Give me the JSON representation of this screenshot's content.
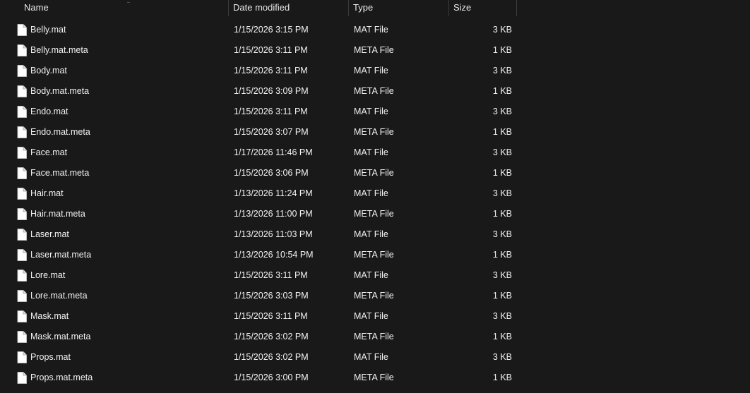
{
  "columns": {
    "name": "Name",
    "date": "Date modified",
    "type": "Type",
    "size": "Size"
  },
  "icons": {
    "file": "file-icon"
  },
  "files": [
    {
      "name": "Belly.mat",
      "date": "1/15/2026 3:15 PM",
      "type": "MAT File",
      "size": "3 KB"
    },
    {
      "name": "Belly.mat.meta",
      "date": "1/15/2026 3:11 PM",
      "type": "META File",
      "size": "1 KB"
    },
    {
      "name": "Body.mat",
      "date": "1/15/2026 3:11 PM",
      "type": "MAT File",
      "size": "3 KB"
    },
    {
      "name": "Body.mat.meta",
      "date": "1/15/2026 3:09 PM",
      "type": "META File",
      "size": "1 KB"
    },
    {
      "name": "Endo.mat",
      "date": "1/15/2026 3:11 PM",
      "type": "MAT File",
      "size": "3 KB"
    },
    {
      "name": "Endo.mat.meta",
      "date": "1/15/2026 3:07 PM",
      "type": "META File",
      "size": "1 KB"
    },
    {
      "name": "Face.mat",
      "date": "1/17/2026 11:46 PM",
      "type": "MAT File",
      "size": "3 KB"
    },
    {
      "name": "Face.mat.meta",
      "date": "1/15/2026 3:06 PM",
      "type": "META File",
      "size": "1 KB"
    },
    {
      "name": "Hair.mat",
      "date": "1/13/2026 11:24 PM",
      "type": "MAT File",
      "size": "3 KB"
    },
    {
      "name": "Hair.mat.meta",
      "date": "1/13/2026 11:00 PM",
      "type": "META File",
      "size": "1 KB"
    },
    {
      "name": "Laser.mat",
      "date": "1/13/2026 11:03 PM",
      "type": "MAT File",
      "size": "3 KB"
    },
    {
      "name": "Laser.mat.meta",
      "date": "1/13/2026 10:54 PM",
      "type": "META File",
      "size": "1 KB"
    },
    {
      "name": "Lore.mat",
      "date": "1/15/2026 3:11 PM",
      "type": "MAT File",
      "size": "3 KB"
    },
    {
      "name": "Lore.mat.meta",
      "date": "1/15/2026 3:03 PM",
      "type": "META File",
      "size": "1 KB"
    },
    {
      "name": "Mask.mat",
      "date": "1/15/2026 3:11 PM",
      "type": "MAT File",
      "size": "3 KB"
    },
    {
      "name": "Mask.mat.meta",
      "date": "1/15/2026 3:02 PM",
      "type": "META File",
      "size": "1 KB"
    },
    {
      "name": "Props.mat",
      "date": "1/15/2026 3:02 PM",
      "type": "MAT File",
      "size": "3 KB"
    },
    {
      "name": "Props.mat.meta",
      "date": "1/15/2026 3:00 PM",
      "type": "META File",
      "size": "1 KB"
    }
  ]
}
